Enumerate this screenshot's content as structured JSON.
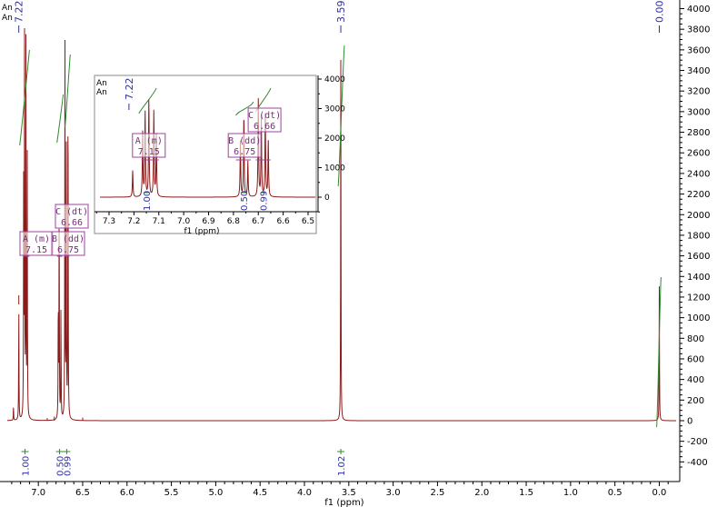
{
  "top_left_labels": [
    "An",
    "An"
  ],
  "inset_top_left_labels": [
    "An",
    "An"
  ],
  "chart_data": [
    {
      "type": "line",
      "subtype": "1H NMR spectrum",
      "xlabel": "f1 (ppm)",
      "x_reversed": true,
      "xlim": [
        7.35,
        -0.2
      ],
      "ylim": [
        -480,
        4050
      ],
      "x_ticks": [
        "7.0",
        "6.5",
        "6.0",
        "5.5",
        "5.0",
        "4.5",
        "4.0",
        "3.5",
        "3.0",
        "2.5",
        "2.0",
        "1.5",
        "1.0",
        "0.5",
        "0.0"
      ],
      "x_tick_values": [
        7.0,
        6.5,
        6.0,
        5.5,
        5.0,
        4.5,
        4.0,
        3.5,
        3.0,
        2.5,
        2.0,
        1.5,
        1.0,
        0.5,
        0.0
      ],
      "y_ticks": [
        "-400",
        "-200",
        "0",
        "200",
        "400",
        "600",
        "800",
        "1000",
        "1200",
        "1400",
        "1600",
        "1800",
        "2000",
        "2200",
        "2400",
        "2600",
        "2800",
        "3000",
        "3200",
        "3400",
        "3600",
        "3800",
        "4000"
      ],
      "y_tick_values": [
        -400,
        -200,
        0,
        200,
        400,
        600,
        800,
        1000,
        1200,
        1400,
        1600,
        1800,
        2000,
        2200,
        2400,
        2600,
        2800,
        3000,
        3200,
        3400,
        3600,
        3800,
        4000
      ],
      "peak_labels": [
        {
          "text": "7.22",
          "ppm": 7.22
        },
        {
          "text": "3.59",
          "ppm": 3.59
        },
        {
          "text": "0.00",
          "ppm": 0.0
        }
      ],
      "peaks": [
        {
          "ppm": 7.28,
          "height": 140
        },
        {
          "ppm": 7.22,
          "height": 1100
        },
        {
          "ppm": 7.165,
          "height": 2400
        },
        {
          "ppm": 7.155,
          "height": 3700
        },
        {
          "ppm": 7.14,
          "height": 3600
        },
        {
          "ppm": 7.125,
          "height": 2600
        },
        {
          "ppm": 6.775,
          "height": 1200
        },
        {
          "ppm": 6.765,
          "height": 2200
        },
        {
          "ppm": 6.745,
          "height": 1100
        },
        {
          "ppm": 6.7,
          "height": 3800
        },
        {
          "ppm": 6.685,
          "height": 3000
        },
        {
          "ppm": 6.665,
          "height": 3500
        },
        {
          "ppm": 3.59,
          "height": 3600
        },
        {
          "ppm": 0.0,
          "height": 1320
        }
      ],
      "multiplets": [
        {
          "letter": "A",
          "mult": "(m)",
          "shift": "7.15"
        },
        {
          "letter": "B",
          "mult": "(dd)",
          "shift": "6.75"
        },
        {
          "letter": "C",
          "mult": "(dt)",
          "shift": "6.66"
        }
      ],
      "integrals": [
        {
          "value": "1.00",
          "ppm": 7.15
        },
        {
          "value": "0.50",
          "ppm": 6.76
        },
        {
          "value": "0.99",
          "ppm": 6.68
        },
        {
          "value": "1.02",
          "ppm": 3.59
        }
      ],
      "colors": {
        "spectrum": "#8b1a1a",
        "integral": "#2e8b2e",
        "label": "#3030a0",
        "multiplet": "#a040a0"
      }
    },
    {
      "type": "line",
      "subtype": "1H NMR spectrum inset (zoom)",
      "xlabel": "f1 (ppm)",
      "x_reversed": true,
      "xlim": [
        7.35,
        6.45
      ],
      "ylim": [
        -600,
        4200
      ],
      "x_ticks": [
        "7.3",
        "7.2",
        "7.1",
        "7.0",
        "6.9",
        "6.8",
        "6.7",
        "6.6",
        "6.5"
      ],
      "x_tick_values": [
        7.3,
        7.2,
        7.1,
        7.0,
        6.9,
        6.8,
        6.7,
        6.6,
        6.5
      ],
      "y_ticks": [
        "0",
        "1000",
        "2000",
        "3000",
        "4000"
      ],
      "y_tick_values": [
        0,
        1000,
        2000,
        3000,
        4000
      ],
      "peak_labels": [
        {
          "text": "7.22",
          "ppm": 7.22
        }
      ],
      "multiplets": [
        {
          "letter": "A",
          "mult": "(m)",
          "shift": "7.15"
        },
        {
          "letter": "B",
          "mult": "(dd)",
          "shift": "6.75"
        },
        {
          "letter": "C",
          "mult": "(dt)",
          "shift": "6.66"
        }
      ],
      "integrals": [
        {
          "value": "1.00",
          "ppm": 7.15
        },
        {
          "value": "0.50",
          "ppm": 6.76
        },
        {
          "value": "0.99",
          "ppm": 6.68
        }
      ]
    }
  ]
}
